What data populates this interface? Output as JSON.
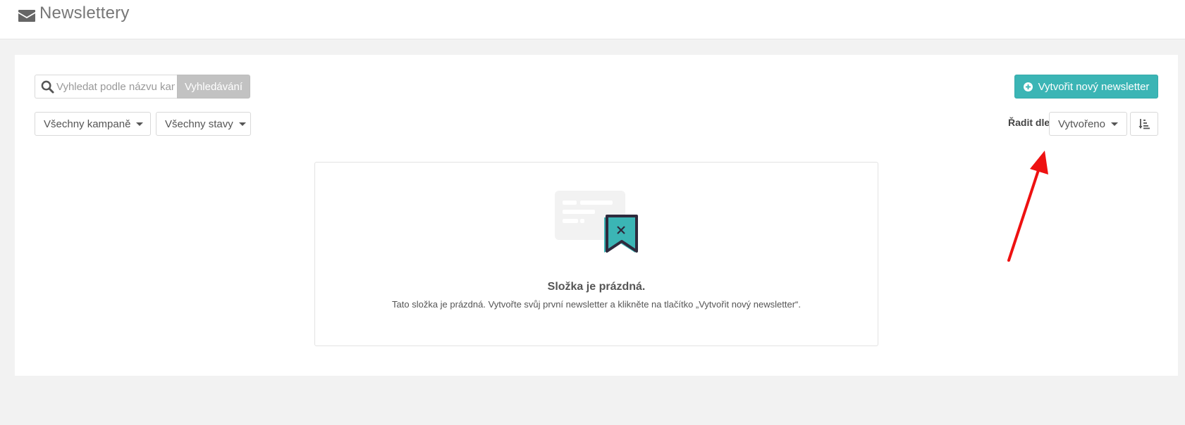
{
  "header": {
    "title": "Newslettery",
    "icon": "envelope-icon"
  },
  "search": {
    "placeholder": "Vyhledat podle názvu kampaně",
    "value": "",
    "button_label": "Vyhledávání",
    "icon": "search-icon"
  },
  "filters": {
    "campaigns": {
      "selected": "Všechny kampaně"
    },
    "states": {
      "selected": "Všechny stavy"
    }
  },
  "create_button": {
    "label": "Vytvořit nový newsletter",
    "icon": "plus-circle-icon",
    "color": "#3bb5b5"
  },
  "sort": {
    "label": "Řadit dle",
    "selected": "Vytvořeno",
    "order_icon": "sort-amount-icon"
  },
  "empty_state": {
    "title": "Složka je prázdná.",
    "text": "Tato složka je prázdná. Vytvořte svůj první newsletter a klikněte na tlačítko „Vytvořit nový newsletter“.",
    "illustration": "empty-folder-illustration",
    "accent_color": "#3bb5b5"
  },
  "annotation": {
    "type": "arrow",
    "color": "#ee1111"
  }
}
